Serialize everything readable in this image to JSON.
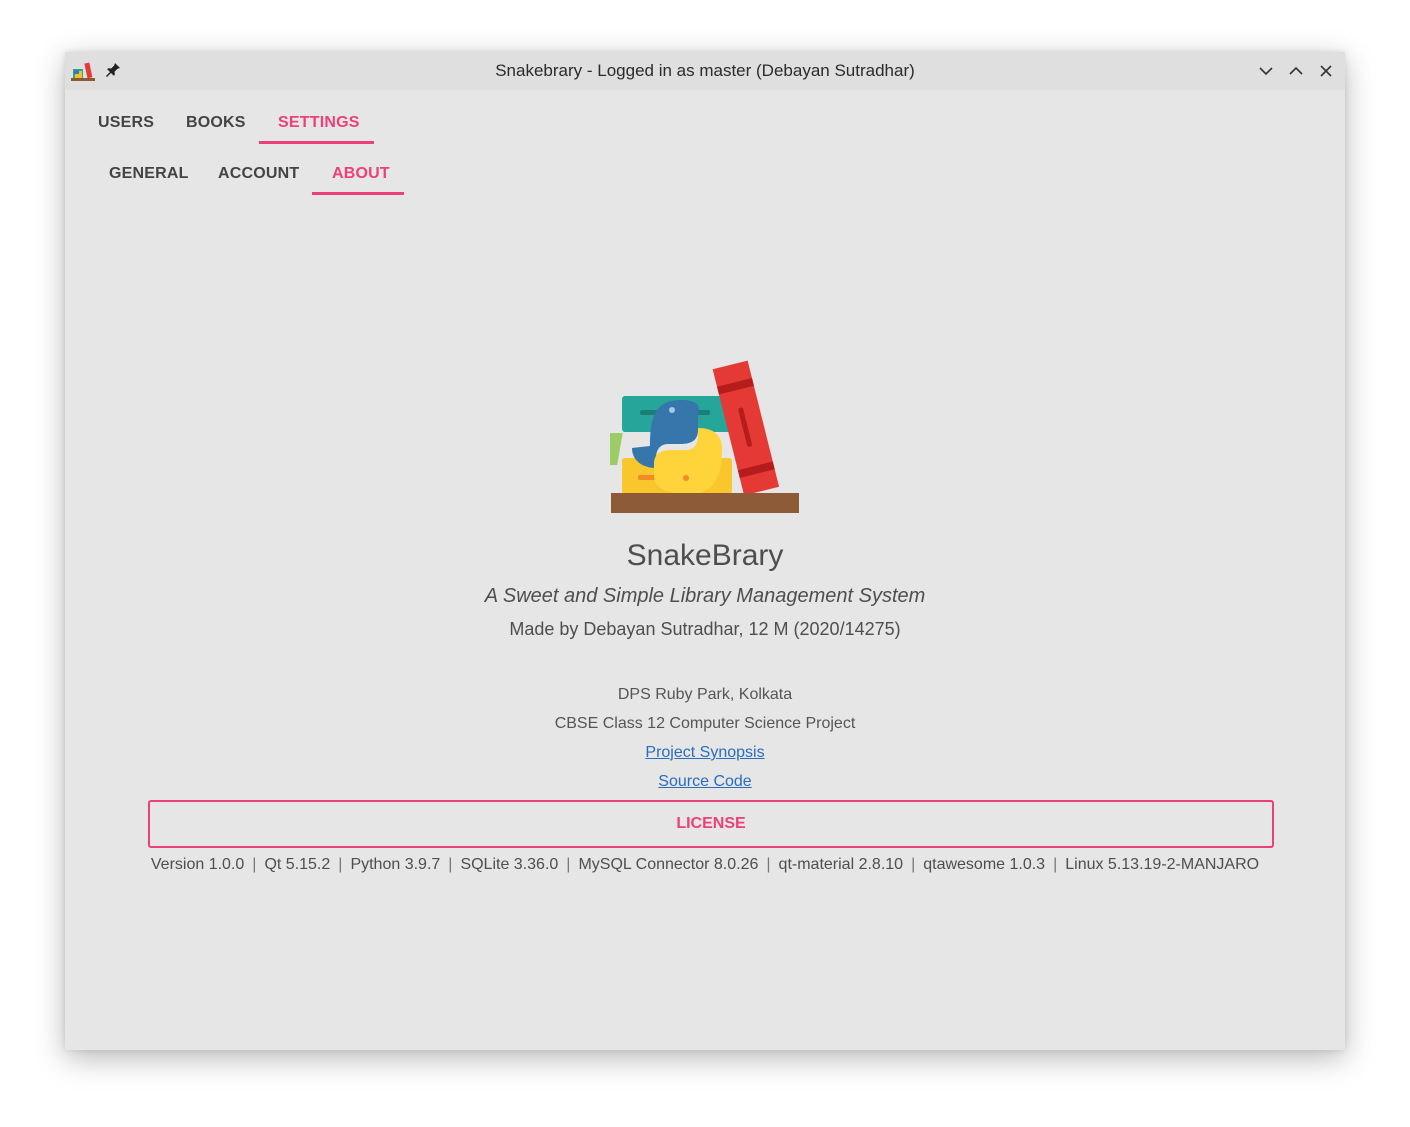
{
  "window": {
    "title": "Snakebrary - Logged in as master (Debayan Sutradhar)"
  },
  "icons": {
    "app": "snakebrary-app-icon",
    "pin": "pin-icon",
    "minimize": "chevron-down-icon",
    "maximize": "chevron-up-icon",
    "close": "close-icon"
  },
  "main_tabs": [
    {
      "label": "USERS",
      "active": false
    },
    {
      "label": "BOOKS",
      "active": false
    },
    {
      "label": "SETTINGS",
      "active": true
    }
  ],
  "sub_tabs": [
    {
      "label": "GENERAL",
      "active": false
    },
    {
      "label": "ACCOUNT",
      "active": false
    },
    {
      "label": "ABOUT",
      "active": true
    }
  ],
  "about": {
    "app_name": "SnakeBrary",
    "tagline": "A Sweet and Simple Library Management System",
    "made_by": "Made by Debayan Sutradhar, 12 M (2020/14275)",
    "school": "DPS Ruby Park, Kolkata",
    "course": "CBSE Class 12 Computer Science Project",
    "synopsis_link": "Project Synopsis",
    "source_link": "Source Code",
    "license_button": "LICENSE",
    "versions": [
      "Version 1.0.0",
      "Qt 5.15.2",
      "Python 3.9.7",
      "SQLite 3.36.0",
      "MySQL Connector 8.0.26",
      "qt-material 2.8.10",
      "qtawesome 1.0.3",
      "Linux 5.13.19-2-MANJARO"
    ],
    "version_separator": "|"
  },
  "colors": {
    "accent": "#ec407a",
    "link": "#2a6ebb",
    "window_bg": "#e6e6e6",
    "titlebar_bg": "#dfdfdf"
  }
}
